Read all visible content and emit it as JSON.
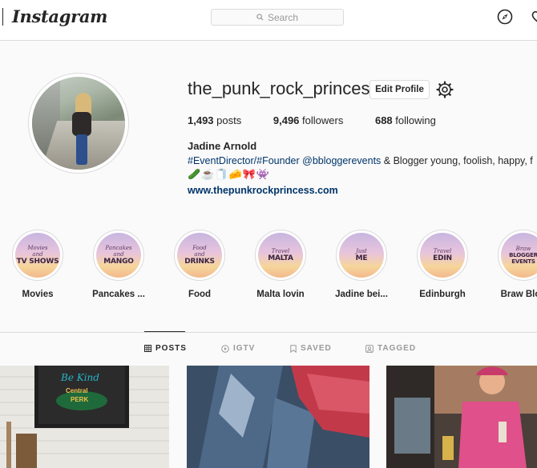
{
  "nav": {
    "logo": "Instagram",
    "search_placeholder": "Search"
  },
  "profile": {
    "username": "the_punk_rock_princess",
    "edit_label": "Edit Profile",
    "posts_count": "1,493",
    "posts_label": "posts",
    "followers_count": "9,496",
    "followers_label": "followers",
    "following_count": "688",
    "following_label": "following",
    "full_name": "Jadine Arnold",
    "bio_tags": "#EventDirector/#Founder @bbloggerevents",
    "bio_text": " & Blogger young, foolish, happy, f",
    "bio_emoji": "🥒☕🧻🧀🎀👾",
    "website": "www.thepunkrockprincess.com"
  },
  "highlights": [
    {
      "label": "Movies",
      "script": "Movies",
      "big": "TV SHOWS",
      "small": "and"
    },
    {
      "label": "Pancakes ...",
      "script": "Pancakes",
      "big": "MANGO",
      "small": "and"
    },
    {
      "label": "Food",
      "script": "Food",
      "big": "DRINKS",
      "small": "and"
    },
    {
      "label": "Malta lovin",
      "script": "Travel",
      "big": "MALTA",
      "small": ""
    },
    {
      "label": "Jadine bei...",
      "script": "Just",
      "big": "ME",
      "small": ""
    },
    {
      "label": "Edinburgh",
      "script": "Travel",
      "big": "EDIN",
      "small": ""
    },
    {
      "label": "Braw Blog",
      "script": "Braw",
      "big": "BLOGGER EVENTS",
      "small": ""
    }
  ],
  "tabs": [
    {
      "label": "POSTS",
      "icon": "grid-icon",
      "active": true
    },
    {
      "label": "IGTV",
      "icon": "igtv-icon",
      "active": false
    },
    {
      "label": "SAVED",
      "icon": "bookmark-icon",
      "active": false
    },
    {
      "label": "TAGGED",
      "icon": "tag-icon",
      "active": false
    }
  ],
  "posts": {
    "post1_sign_1": "Central",
    "post1_sign_2": "PERK",
    "post1_sign_script": "Be Kind"
  }
}
